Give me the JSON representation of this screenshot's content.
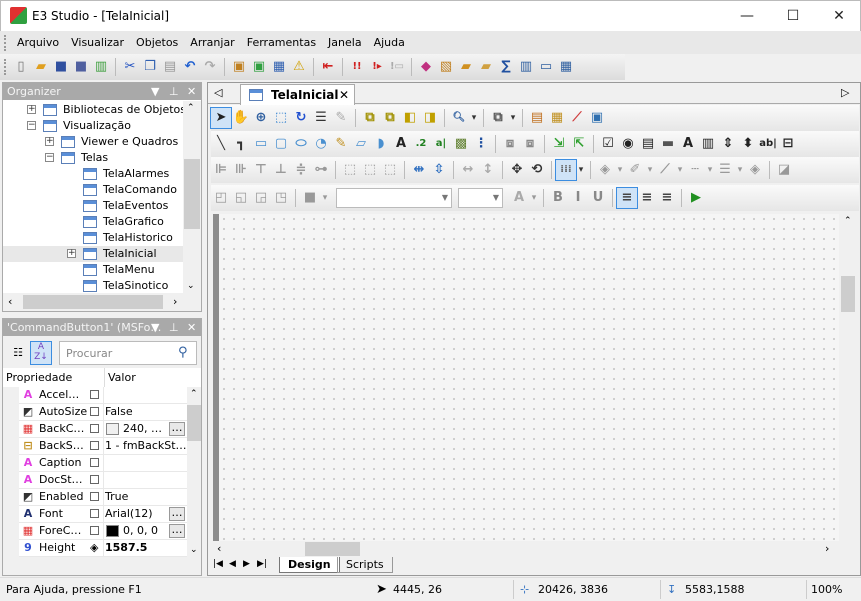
{
  "window": {
    "title": "E3 Studio - [TelaInicial]",
    "minimize": "—",
    "maximize": "☐",
    "close": "✕"
  },
  "menu": [
    "Arquivo",
    "Visualizar",
    "Objetos",
    "Arranjar",
    "Ferramentas",
    "Janela",
    "Ajuda"
  ],
  "main_toolbar": [
    {
      "name": "new-icon",
      "g": "▯",
      "c": "#777"
    },
    {
      "name": "open-icon",
      "g": "▰",
      "c": "#e0a020"
    },
    {
      "name": "save-icon",
      "g": "■",
      "c": "#3050a0"
    },
    {
      "name": "save-all-icon",
      "g": "■",
      "c": "#5060a0"
    },
    {
      "name": "publish-icon",
      "g": "▥",
      "c": "#40a040"
    },
    {
      "sep": true
    },
    {
      "name": "cut-icon",
      "g": "✂",
      "c": "#2050c0"
    },
    {
      "name": "copy-icon",
      "g": "❐",
      "c": "#3060b0"
    },
    {
      "name": "paste-icon",
      "g": "▤",
      "c": "#999"
    },
    {
      "name": "undo-icon",
      "g": "↶",
      "c": "#2060d0"
    },
    {
      "name": "redo-icon",
      "g": "↷",
      "c": "#aaa"
    },
    {
      "sep": true
    },
    {
      "name": "new-screen-icon",
      "g": "▣",
      "c": "#c08020"
    },
    {
      "name": "insert-icon",
      "g": "▣",
      "c": "#30a040"
    },
    {
      "name": "properties-icon",
      "g": "▦",
      "c": "#3060b0"
    },
    {
      "name": "verify-icon",
      "g": "⚠",
      "c": "#d0a000"
    },
    {
      "sep": true
    },
    {
      "name": "import-icon",
      "g": "⇤",
      "c": "#d02020"
    },
    {
      "sep": true
    },
    {
      "name": "stop-icon",
      "g": "!!",
      "c": "#d02020"
    },
    {
      "name": "run-icon",
      "g": "!▸",
      "c": "#d02020"
    },
    {
      "name": "disabled-icon",
      "g": "!▭",
      "c": "#aaa"
    },
    {
      "sep": true
    },
    {
      "name": "gems-icon",
      "g": "◆",
      "c": "#c03080"
    },
    {
      "name": "packages-icon",
      "g": "▧",
      "c": "#c08020"
    },
    {
      "name": "folder-tools-icon",
      "g": "▰",
      "c": "#d09020"
    },
    {
      "name": "folder-icon",
      "g": "▰",
      "c": "#d0a040"
    },
    {
      "name": "sum-icon",
      "g": "∑",
      "c": "#2050a0"
    },
    {
      "name": "book-icon",
      "g": "▥",
      "c": "#3060a0"
    },
    {
      "name": "counter-icon",
      "g": "▭",
      "c": "#3060a0"
    },
    {
      "name": "report-icon",
      "g": "▦",
      "c": "#3060a0"
    }
  ],
  "organizer": {
    "title": "Organizer",
    "tree": [
      {
        "label": "Bibliotecas de Objetos",
        "level": 0,
        "exp": "+"
      },
      {
        "label": "Visualização",
        "level": 0,
        "exp": "−"
      },
      {
        "label": "Viewer e Quadros",
        "level": 1,
        "exp": "+"
      },
      {
        "label": "Telas",
        "level": 1,
        "exp": "−"
      },
      {
        "label": "TelaAlarmes",
        "level": 2,
        "exp": ""
      },
      {
        "label": "TelaComando",
        "level": 2,
        "exp": ""
      },
      {
        "label": "TelaEventos",
        "level": 2,
        "exp": ""
      },
      {
        "label": "TelaGrafico",
        "level": 2,
        "exp": ""
      },
      {
        "label": "TelaHistorico",
        "level": 2,
        "exp": ""
      },
      {
        "label": "TelaInicial",
        "level": 2,
        "exp": "+",
        "selected": true
      },
      {
        "label": "TelaMenu",
        "level": 2,
        "exp": ""
      },
      {
        "label": "TelaSinotico",
        "level": 2,
        "exp": ""
      }
    ]
  },
  "properties": {
    "title": "'CommandButton1' (MSFo…",
    "search_placeholder": "Procurar",
    "col_name": "Propriedade",
    "col_value": "Valor",
    "rows": [
      {
        "name": "Accel…",
        "icon": "A",
        "ic": "#e040e0",
        "value": "",
        "btn": false
      },
      {
        "name": "AutoSize",
        "icon": "◩",
        "ic": "#333",
        "value": "False",
        "btn": false
      },
      {
        "name": "BackC…",
        "icon": "▦",
        "ic": "#e03030",
        "value": "240, …",
        "swatch": "#f0f0f0",
        "btn": true
      },
      {
        "name": "BackS…",
        "icon": "⊟",
        "ic": "#c09020",
        "value": "1 - fmBackSt…",
        "btn": false
      },
      {
        "name": "Caption",
        "icon": "A",
        "ic": "#e040e0",
        "value": "",
        "btn": false
      },
      {
        "name": "DocSt…",
        "icon": "A",
        "ic": "#e040e0",
        "value": "",
        "btn": false
      },
      {
        "name": "Enabled",
        "icon": "◩",
        "ic": "#333",
        "value": "True",
        "btn": false
      },
      {
        "name": "Font",
        "icon": "A",
        "ic": "#203070",
        "value": "Arial(12)",
        "btn": true
      },
      {
        "name": "ForeC…",
        "icon": "▦",
        "ic": "#e03030",
        "value": "0, 0, 0",
        "swatch": "#000000",
        "btn": true
      },
      {
        "name": "Height",
        "icon": "9",
        "ic": "#3050d0",
        "value": "1587.5",
        "bold": true,
        "btn": false
      }
    ]
  },
  "document": {
    "tab": "TelaInicial",
    "sheet_tabs": [
      "Design",
      "Scripts"
    ],
    "toolbar1": [
      {
        "name": "select-icon",
        "g": "➤",
        "c": "#222",
        "sel": true
      },
      {
        "name": "pan-icon",
        "g": "✋",
        "c": "#666"
      },
      {
        "name": "zoom-icon",
        "g": "⊕",
        "c": "#3060a0"
      },
      {
        "name": "zoom-fit-icon",
        "g": "⬚",
        "c": "#3080d0"
      },
      {
        "name": "refresh-icon",
        "g": "↻",
        "c": "#2050d0"
      },
      {
        "name": "list-icon",
        "g": "☰",
        "c": "#333"
      },
      {
        "name": "disabled-edit-icon",
        "g": "✎",
        "c": "#aaa"
      },
      {
        "sep": true
      },
      {
        "name": "bring-front-icon",
        "g": "⧉",
        "c": "#a09000"
      },
      {
        "name": "send-back-icon",
        "g": "⧉",
        "c": "#a09000"
      },
      {
        "name": "bring-forward-icon",
        "g": "◧",
        "c": "#c0a000"
      },
      {
        "name": "send-backward-icon",
        "g": "◨",
        "c": "#c0a000"
      },
      {
        "sep": true
      },
      {
        "name": "magnifier-icon",
        "g": "🔍︎",
        "c": "#3060a0"
      },
      {
        "name": "dropdown-icon",
        "g": "▾",
        "c": "#333"
      },
      {
        "sep": true
      },
      {
        "name": "group-icon",
        "g": "⧉",
        "c": "#555"
      },
      {
        "name": "dropdown-icon",
        "g": "▾",
        "c": "#333"
      },
      {
        "sep": true
      },
      {
        "name": "tag-icon",
        "g": "▤",
        "c": "#c07020"
      },
      {
        "name": "table-icon",
        "g": "▦",
        "c": "#c09020"
      },
      {
        "name": "chart-icon",
        "g": "⟋",
        "c": "#d04040"
      },
      {
        "name": "query-icon",
        "g": "▣",
        "c": "#3070b0"
      }
    ],
    "toolbar2": [
      {
        "name": "line-icon",
        "g": "╲",
        "c": "#333"
      },
      {
        "name": "polyline-icon",
        "g": "┓",
        "c": "#333"
      },
      {
        "name": "rectangle-icon",
        "g": "▭",
        "c": "#4a90d0"
      },
      {
        "name": "rounded-rect-icon",
        "g": "▢",
        "c": "#4a90d0"
      },
      {
        "name": "ellipse-icon",
        "g": "⬭",
        "c": "#4a90d0"
      },
      {
        "name": "arc-icon",
        "g": "◔",
        "c": "#4a90d0"
      },
      {
        "name": "pencil-icon",
        "g": "✎",
        "c": "#c09020"
      },
      {
        "name": "polygon-icon",
        "g": "▱",
        "c": "#4a90d0"
      },
      {
        "name": "curve-icon",
        "g": "◗",
        "c": "#4a90d0"
      },
      {
        "name": "text-icon",
        "g": "A",
        "c": "#222"
      },
      {
        "name": "display-icon",
        "g": ".2",
        "c": "#208020"
      },
      {
        "name": "setpoint-icon",
        "g": "a|",
        "c": "#208020"
      },
      {
        "name": "image-icon",
        "g": "▩",
        "c": "#608030"
      },
      {
        "name": "scale-icon",
        "g": "⋮",
        "c": "#2050a0"
      },
      {
        "sep": true
      },
      {
        "name": "ungroup-icon",
        "g": "⧈",
        "c": "#888"
      },
      {
        "name": "group-objects-icon",
        "g": "⧈",
        "c": "#888"
      },
      {
        "sep": true
      },
      {
        "name": "connector-icon",
        "g": "⇲",
        "c": "#30a030"
      },
      {
        "name": "connector2-icon",
        "g": "⇱",
        "c": "#30a030"
      },
      {
        "sep": true
      },
      {
        "name": "checkbox-icon",
        "g": "☑",
        "c": "#222"
      },
      {
        "name": "radio-icon",
        "g": "◉",
        "c": "#222"
      },
      {
        "name": "listbox-icon",
        "g": "▤",
        "c": "#222"
      },
      {
        "name": "button-icon",
        "g": "▬",
        "c": "#555"
      },
      {
        "name": "label-icon",
        "g": "A",
        "c": "#222"
      },
      {
        "name": "combobox-icon",
        "g": "▥",
        "c": "#222"
      },
      {
        "name": "spin-icon",
        "g": "⇕",
        "c": "#222"
      },
      {
        "name": "scroll-icon",
        "g": "⬍",
        "c": "#222"
      },
      {
        "name": "textbox-icon",
        "g": "ab|",
        "c": "#222"
      },
      {
        "name": "toggle-icon",
        "g": "⊟",
        "c": "#222"
      }
    ],
    "toolbar3": [
      {
        "name": "align-left-icon",
        "g": "⊫",
        "c": "#999"
      },
      {
        "name": "align-right-icon",
        "g": "⊪",
        "c": "#999"
      },
      {
        "name": "align-top-icon",
        "g": "⊤",
        "c": "#999"
      },
      {
        "name": "align-bottom-icon",
        "g": "⊥",
        "c": "#999"
      },
      {
        "name": "align-center-icon",
        "g": "≑",
        "c": "#999"
      },
      {
        "name": "align-middle-icon",
        "g": "⊶",
        "c": "#999"
      },
      {
        "sep": true
      },
      {
        "name": "same-width-icon",
        "g": "⬚",
        "c": "#999"
      },
      {
        "name": "same-height-icon",
        "g": "⬚",
        "c": "#999"
      },
      {
        "name": "same-size-icon",
        "g": "⬚",
        "c": "#999"
      },
      {
        "sep": true
      },
      {
        "name": "center-horizontal-icon",
        "g": "⇹",
        "c": "#3070c0"
      },
      {
        "name": "center-vertical-icon",
        "g": "⇳",
        "c": "#3070c0"
      },
      {
        "sep": true
      },
      {
        "name": "space-h-icon",
        "g": "↔",
        "c": "#aaa"
      },
      {
        "name": "space-v-icon",
        "g": "↕",
        "c": "#aaa"
      },
      {
        "sep": true
      },
      {
        "name": "move-icon",
        "g": "✥",
        "c": "#333"
      },
      {
        "name": "rotate-icon",
        "g": "⟲",
        "c": "#333"
      },
      {
        "sep": true
      },
      {
        "name": "grid-icon",
        "g": "⁞⁞⁞",
        "c": "#666",
        "sel": true
      },
      {
        "name": "dropdown-icon",
        "g": "▾",
        "c": "#333"
      },
      {
        "sep": true
      },
      {
        "name": "fill-color-icon",
        "g": "◈",
        "c": "#999"
      },
      {
        "name": "dropdown-icon",
        "g": "▾",
        "c": "#999"
      },
      {
        "name": "brush-color-icon",
        "g": "✐",
        "c": "#999"
      },
      {
        "name": "dropdown-icon",
        "g": "▾",
        "c": "#999"
      },
      {
        "name": "line-color-icon",
        "g": "⟋",
        "c": "#999"
      },
      {
        "name": "dropdown-icon",
        "g": "▾",
        "c": "#999"
      },
      {
        "name": "line-style-icon",
        "g": "┄",
        "c": "#999"
      },
      {
        "name": "dropdown-icon",
        "g": "▾",
        "c": "#999"
      },
      {
        "name": "line-width-icon",
        "g": "☰",
        "c": "#999"
      },
      {
        "name": "dropdown-icon",
        "g": "▾",
        "c": "#999"
      },
      {
        "name": "fill-style-icon",
        "g": "◈",
        "c": "#999"
      },
      {
        "sep": true
      },
      {
        "name": "transparency-icon",
        "g": "◪",
        "c": "#999"
      }
    ],
    "toolbar4": [
      {
        "name": "order-up-icon",
        "g": "◰",
        "c": "#999"
      },
      {
        "name": "order-down-icon",
        "g": "◱",
        "c": "#999"
      },
      {
        "name": "flip-h-icon",
        "g": "◲",
        "c": "#999"
      },
      {
        "name": "flip-v-icon",
        "g": "◳",
        "c": "#999"
      },
      {
        "sep": true
      },
      {
        "name": "fore-color-icon",
        "g": "■",
        "c": "#999"
      },
      {
        "name": "dropdown-icon",
        "g": "▾",
        "c": "#999"
      }
    ],
    "toolbar4b": [
      {
        "name": "font-color-icon",
        "g": "A",
        "c": "#aaa"
      },
      {
        "name": "dropdown-icon",
        "g": "▾",
        "c": "#999"
      },
      {
        "sep": true
      },
      {
        "name": "bold-icon",
        "g": "B",
        "c": "#888"
      },
      {
        "name": "italic-icon",
        "g": "I",
        "c": "#888"
      },
      {
        "name": "underline-icon",
        "g": "U",
        "c": "#888"
      },
      {
        "sep": true
      },
      {
        "name": "text-align-left-icon",
        "g": "≡",
        "c": "#444",
        "sel": true
      },
      {
        "name": "text-align-center-icon",
        "g": "≡",
        "c": "#444"
      },
      {
        "name": "text-align-right-icon",
        "g": "≡",
        "c": "#444"
      },
      {
        "sep": true
      },
      {
        "name": "play-icon",
        "g": "▶",
        "c": "#209020"
      }
    ]
  },
  "status": {
    "help": "Para Ajuda, pressione F1",
    "cursor": "4445, 26",
    "position": "20426, 3836",
    "size": "5583,1588",
    "zoom": "100%"
  }
}
